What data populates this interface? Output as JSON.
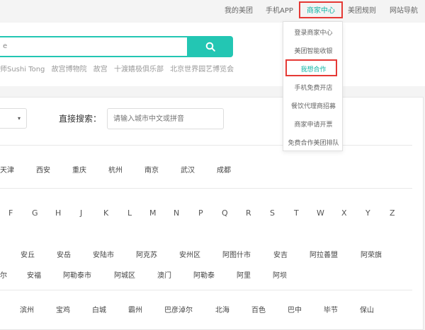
{
  "topnav": {
    "items": [
      "我的美团",
      "手机APP",
      "商家中心",
      "美团规则",
      "网站导航"
    ],
    "active": "商家中心"
  },
  "dropdown": {
    "items": [
      "登录商家中心",
      "美团智能收银",
      "我想合作",
      "手机免费开店",
      "餐饮代理商招募",
      "商家申请开票",
      "免费合作美团排队"
    ]
  },
  "search": {
    "value": "e",
    "button_icon": "search-icon",
    "hot_words": [
      "师Sushi Tong",
      "故宫博物院",
      "故宫",
      "十渡嬉极俱乐部",
      "北京世界园艺博览会"
    ]
  },
  "filter": {
    "direct_label": "直接搜索：",
    "placeholder": "请输入城市中文或拼音",
    "select_caret": "▾"
  },
  "hot_cities": [
    "天津",
    "西安",
    "重庆",
    "杭州",
    "南京",
    "武汉",
    "成都"
  ],
  "letters": [
    "F",
    "G",
    "H",
    "J",
    "K",
    "L",
    "M",
    "N",
    "P",
    "Q",
    "R",
    "S",
    "T",
    "W",
    "X",
    "Y",
    "Z"
  ],
  "city_rows": [
    [
      "安丘",
      "安岳",
      "安陆市",
      "阿克苏",
      "安州区",
      "阿图什市",
      "安吉",
      "阿拉善盟",
      "阿荣旗"
    ],
    [
      "尔",
      "安福",
      "阿勒泰市",
      "阿城区",
      "澳门",
      "阿勒泰",
      "阿里",
      "阿坝"
    ],
    [
      "滨州",
      "宝鸡",
      "白城",
      "霸州",
      "巴彦淖尔",
      "北海",
      "百色",
      "巴中",
      "毕节",
      "保山"
    ]
  ],
  "colors": {
    "accent": "#23c6b3",
    "active_text": "#11b5a6",
    "highlight_border": "#e53935"
  }
}
